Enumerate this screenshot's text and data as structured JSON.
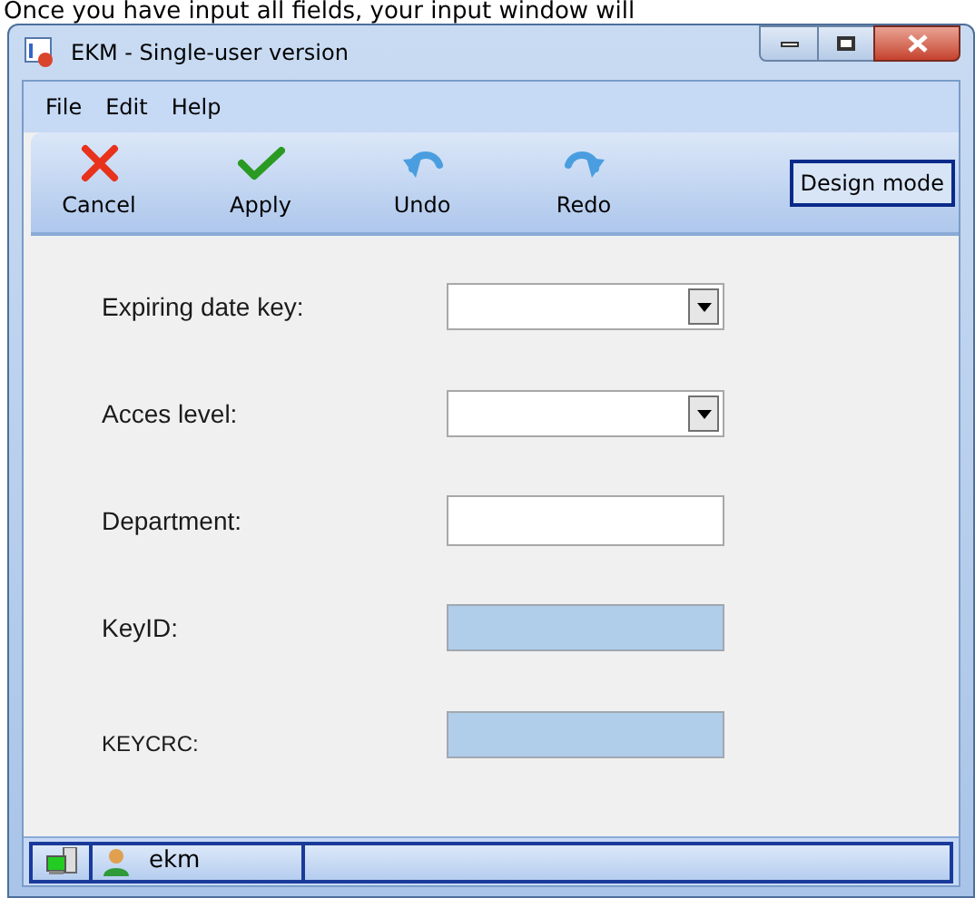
{
  "document_text": "Once you have input all fields, your input window will",
  "window": {
    "title": "EKM - Single-user version"
  },
  "menu": [
    "File",
    "Edit",
    "Help"
  ],
  "toolbar": [
    {
      "label": "Cancel",
      "kind": "cancel"
    },
    {
      "label": "Apply",
      "kind": "apply"
    },
    {
      "label": "Undo",
      "kind": "undo"
    },
    {
      "label": "Redo",
      "kind": "redo"
    }
  ],
  "design_mode_button": "Design mode",
  "fields": [
    {
      "label": "Expiring date key:",
      "kind": "dropdown"
    },
    {
      "label": "Acces level:",
      "kind": "dropdown"
    },
    {
      "label": "Department:",
      "kind": "text"
    },
    {
      "label": "KeyID:",
      "kind": "readonly"
    },
    {
      "label": "KEYCRC:",
      "kind": "readonly"
    }
  ],
  "status_bar": {
    "user": "ekm"
  }
}
